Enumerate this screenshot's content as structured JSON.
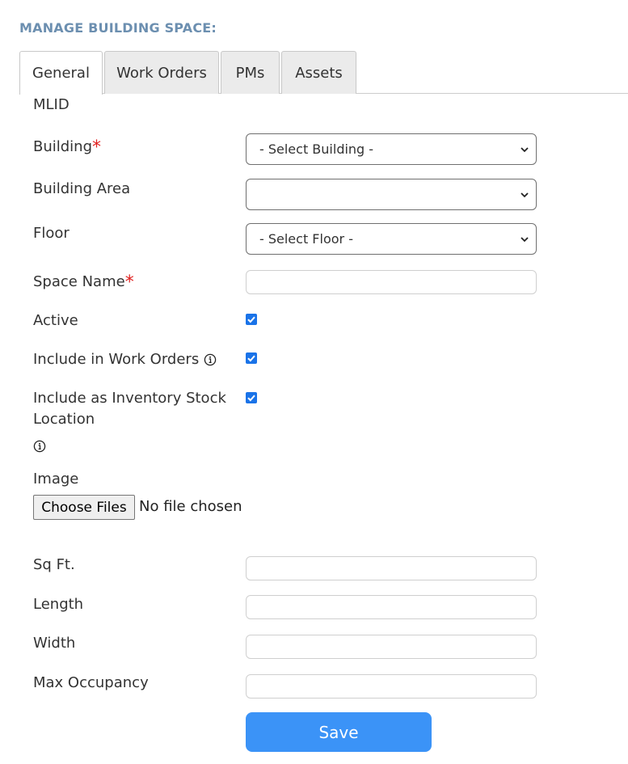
{
  "page": {
    "title": "MANAGE BUILDING SPACE:"
  },
  "tabs": [
    {
      "label": "General",
      "active": true
    },
    {
      "label": "Work Orders",
      "active": false
    },
    {
      "label": "PMs",
      "active": false
    },
    {
      "label": "Assets",
      "active": false
    }
  ],
  "form": {
    "mlid_label": "MLID",
    "building": {
      "label": "Building",
      "required_mark": "*",
      "selected": "- Select Building -"
    },
    "building_area": {
      "label": "Building Area",
      "selected": ""
    },
    "floor": {
      "label": "Floor",
      "selected": "- Select Floor -"
    },
    "space_name": {
      "label": "Space Name",
      "required_mark": "*",
      "value": ""
    },
    "active": {
      "label": "Active",
      "checked": true
    },
    "include_work_orders": {
      "label": "Include in Work Orders",
      "checked": true,
      "icon": "info-icon"
    },
    "include_inventory": {
      "label": "Include as Inventory Stock Location",
      "checked": true,
      "icon": "info-icon"
    },
    "image": {
      "label": "Image",
      "button_label": "Choose Files",
      "status": "No file chosen"
    },
    "sq_ft": {
      "label": "Sq Ft.",
      "value": ""
    },
    "length": {
      "label": "Length",
      "value": ""
    },
    "width": {
      "label": "Width",
      "value": ""
    },
    "max_occupancy": {
      "label": "Max Occupancy",
      "value": ""
    },
    "save_label": "Save"
  },
  "colors": {
    "title": "#6c8fb0",
    "required": "#e0201f",
    "checkbox": "#1a73e8",
    "save_button": "#3b93f7"
  }
}
